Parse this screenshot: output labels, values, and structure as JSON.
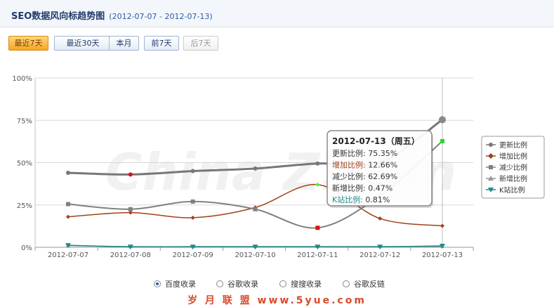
{
  "header": {
    "title": "SEO数据风向标趋势图",
    "date_range": "(2012-07-07 - 2012-07-13)"
  },
  "range_buttons": [
    {
      "label": "最近7天",
      "state": "active"
    },
    {
      "label": "最近30天",
      "state": "normal"
    },
    {
      "label": "本月",
      "state": "normal"
    },
    {
      "label": "前7天",
      "state": "normal"
    },
    {
      "label": "后7天",
      "state": "disabled"
    }
  ],
  "chart_data": {
    "type": "line",
    "title": "",
    "xlabel": "",
    "ylabel": "",
    "categories": [
      "2012-07-07",
      "2012-07-08",
      "2012-07-09",
      "2012-07-10",
      "2012-07-11",
      "2012-07-12",
      "2012-07-13"
    ],
    "y_ticks": [
      "0%",
      "25%",
      "50%",
      "75%",
      "100%"
    ],
    "ylim": [
      0,
      100
    ],
    "grid": "horizontal",
    "legend_position": "right",
    "series": [
      {
        "name": "更新比例",
        "color": "#777777",
        "marker": "circle",
        "values": [
          44,
          43,
          45,
          46.5,
          49.5,
          50,
          75.35
        ]
      },
      {
        "name": "增加比例",
        "color": "#a0421a",
        "marker": "diamond",
        "values": [
          18,
          20.5,
          17.5,
          23.5,
          37,
          17,
          12.66
        ]
      },
      {
        "name": "减少比例",
        "color": "#808080",
        "marker": "square",
        "values": [
          25.5,
          22.5,
          27,
          22.5,
          11.5,
          30.5,
          62.69
        ]
      },
      {
        "name": "新增比例",
        "color": "#999999",
        "marker": "triangle",
        "values": [
          1,
          0.4,
          0.4,
          0.4,
          0.4,
          0.4,
          0.47
        ]
      },
      {
        "name": "K站比例",
        "color": "#1f8a8a",
        "marker": "triangle-down",
        "values": [
          1.2,
          0.3,
          0.3,
          0.3,
          0.3,
          0.3,
          0.81
        ]
      }
    ],
    "watermark": "China Z.com",
    "tooltip": {
      "header": "2012-07-13（周五）",
      "rows": [
        {
          "label": "更新比例:",
          "value": "75.35%",
          "color": "#333333"
        },
        {
          "label": "增加比例:",
          "value": "12.66%",
          "color": "#a0421a"
        },
        {
          "label": "减少比例:",
          "value": "62.69%",
          "color": "#333333"
        },
        {
          "label": "新增比例:",
          "value": "0.47%",
          "color": "#333333"
        },
        {
          "label": "K站比例:",
          "value": "0.81%",
          "color": "#1f8a8a"
        }
      ]
    }
  },
  "radio_options": [
    {
      "label": "百度收录",
      "checked": true
    },
    {
      "label": "谷歌收录",
      "checked": false
    },
    {
      "label": "搜搜收录",
      "checked": false
    },
    {
      "label": "谷歌反链",
      "checked": false
    }
  ],
  "footer": {
    "text": "岁 月 联 盟  www.5yue.com"
  }
}
